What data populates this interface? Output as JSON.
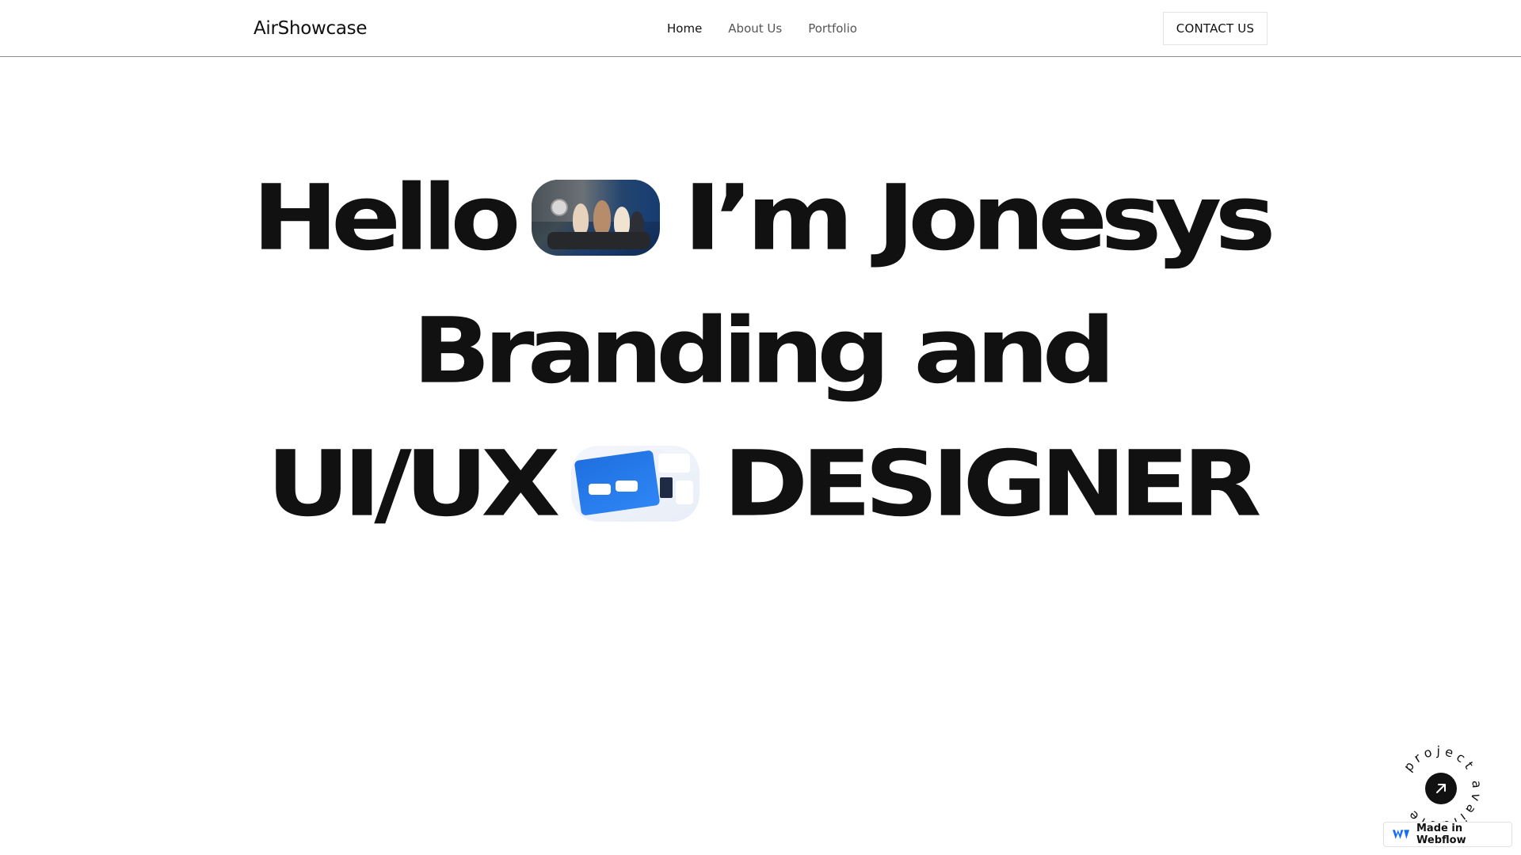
{
  "nav": {
    "brand": "AirShowcase",
    "links": [
      {
        "label": "Home",
        "active": true
      },
      {
        "label": "About Us",
        "active": false
      },
      {
        "label": "Portfolio",
        "active": false
      }
    ],
    "cta": "CONTACT US"
  },
  "hero": {
    "line1": {
      "word1": "Hello",
      "word2": "I’m",
      "word3": "Jonesys"
    },
    "line2": {
      "word1": "Branding",
      "word2": "and"
    },
    "line3": {
      "word1": "UI/UX",
      "word2": "DESIGNER"
    },
    "images": [
      {
        "name": "team-photo",
        "description": "team meeting photo"
      },
      {
        "name": "ui-design-thumbnail",
        "description": "UI design preview"
      }
    ]
  },
  "badge": {
    "ring_text": "project available",
    "icon": "arrow-up-right-icon"
  },
  "footer_badge": {
    "label": "Made in Webflow",
    "icon": "webflow-logo-icon"
  },
  "colors": {
    "text": "#111111",
    "muted": "#555555",
    "border": "#8a8a8a",
    "accent_blue": "#146ef5"
  }
}
